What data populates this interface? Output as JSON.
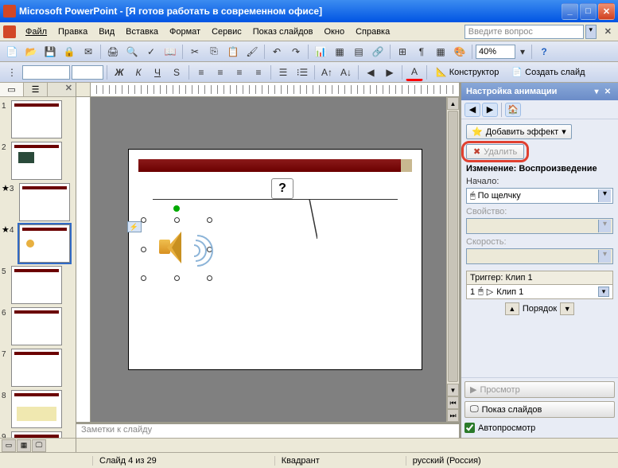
{
  "app": {
    "title": "Microsoft PowerPoint - [Я готов работать в современном офисе]"
  },
  "menu": {
    "items": [
      "Файл",
      "Правка",
      "Вид",
      "Вставка",
      "Формат",
      "Сервис",
      "Показ слайдов",
      "Окно",
      "Справка"
    ],
    "question_placeholder": "Введите вопрос"
  },
  "toolbar": {
    "zoom": "40%"
  },
  "fmt": {
    "designer": "Конструктор",
    "new_slide": "Создать слайд"
  },
  "thumbs": {
    "slides": [
      1,
      2,
      3,
      4,
      5,
      6,
      7,
      8,
      9
    ],
    "selected": 4,
    "animated": [
      3,
      4
    ]
  },
  "notes": {
    "placeholder": "Заметки к слайду"
  },
  "callout": {
    "q": "?"
  },
  "taskpane": {
    "title": "Настройка анимации",
    "add_effect": "Добавить эффект",
    "remove": "Удалить",
    "section": "Изменение: Воспроизведение",
    "start_label": "Начало:",
    "start_value": "По щелчку",
    "property_label": "Свойство:",
    "speed_label": "Скорость:",
    "trigger_header": "Триггер: Клип 1",
    "trigger_num": "1",
    "trigger_item": "Клип 1",
    "order_label": "Порядок",
    "preview": "Просмотр",
    "slideshow": "Показ слайдов",
    "autopreview": "Автопросмотр"
  },
  "status": {
    "slide": "Слайд 4 из 29",
    "template": "Квадрант",
    "lang": "русский (Россия)"
  }
}
